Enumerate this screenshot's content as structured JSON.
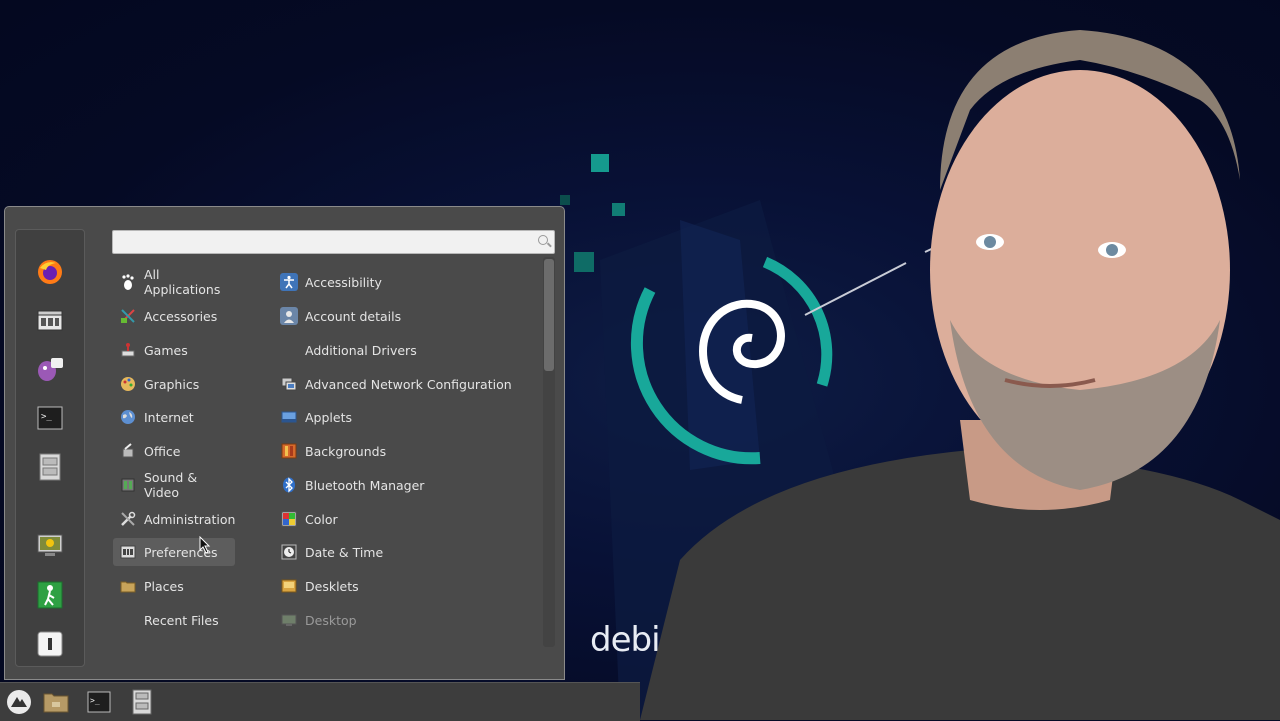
{
  "wallpaper": {
    "brand_text": "debi"
  },
  "menu": {
    "search": {
      "value": "",
      "placeholder": ""
    },
    "favorites": [
      {
        "name": "firefox-icon"
      },
      {
        "name": "software-manager-icon"
      },
      {
        "name": "pidgin-icon"
      },
      {
        "name": "terminal-icon"
      },
      {
        "name": "file-manager-icon"
      },
      {
        "name": "lock-screen-icon"
      },
      {
        "name": "logout-icon"
      },
      {
        "name": "shutdown-icon"
      }
    ],
    "categories": [
      {
        "label": "All Applications",
        "icon": "gnome-foot-icon"
      },
      {
        "label": "Accessories",
        "icon": "accessories-icon"
      },
      {
        "label": "Games",
        "icon": "games-icon"
      },
      {
        "label": "Graphics",
        "icon": "graphics-icon"
      },
      {
        "label": "Internet",
        "icon": "globe-icon"
      },
      {
        "label": "Office",
        "icon": "office-icon"
      },
      {
        "label": "Sound & Video",
        "icon": "multimedia-icon"
      },
      {
        "label": "Administration",
        "icon": "tools-icon"
      },
      {
        "label": "Preferences",
        "icon": "preferences-icon"
      },
      {
        "label": "Places",
        "icon": "folder-icon"
      },
      {
        "label": "Recent Files",
        "icon": ""
      }
    ],
    "apps": [
      {
        "label": "Accessibility",
        "icon": "accessibility-icon"
      },
      {
        "label": "Account details",
        "icon": "user-account-icon"
      },
      {
        "label": "Additional Drivers",
        "icon": ""
      },
      {
        "label": "Advanced Network Configuration",
        "icon": "network-icon"
      },
      {
        "label": "Applets",
        "icon": "applets-icon"
      },
      {
        "label": "Backgrounds",
        "icon": "backgrounds-icon"
      },
      {
        "label": "Bluetooth Manager",
        "icon": "bluetooth-icon"
      },
      {
        "label": "Color",
        "icon": "color-icon"
      },
      {
        "label": "Date & Time",
        "icon": "clock-icon"
      },
      {
        "label": "Desklets",
        "icon": "desklets-icon"
      },
      {
        "label": "Desktop",
        "icon": "desktop-icon"
      }
    ]
  },
  "taskbar": {
    "items": [
      {
        "name": "menu-button-icon"
      },
      {
        "name": "file-manager-launcher-icon"
      },
      {
        "name": "terminal-launcher-icon"
      },
      {
        "name": "file-cabinet-launcher-icon"
      }
    ]
  },
  "colors": {
    "accent_teal": "#18a89a",
    "menu_bg": "#4a4a4a",
    "desktop_bg": "#060b26"
  }
}
